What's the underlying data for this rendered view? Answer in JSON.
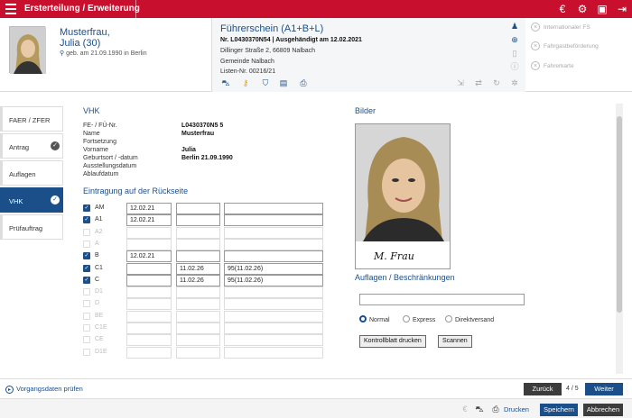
{
  "topbar": {
    "title": "Ersterteilung / Erweiterung",
    "icons": [
      "euro-icon",
      "gear-icon",
      "sidebar-toggle-icon",
      "logout-icon"
    ]
  },
  "person": {
    "name_line1": "Musterfrau,",
    "name_line2": "Julia (30)",
    "birth": "geb. am 21.09.1990 in Berlin"
  },
  "license": {
    "title": "Führerschein (A1+B+L)",
    "number_line": "Nr. L0430370N54 | Ausgehändigt am 12.02.2021",
    "address_line": "Dillinger Straße 2, 66809 Nalbach",
    "gemeinde_line": "Gemeinde Nalbach",
    "listen_line": "Listen-Nr. 00216/21"
  },
  "related": {
    "items": [
      "Internationaler FS",
      "Fahrgastbeförderung",
      "Fahrerkarte"
    ]
  },
  "nav": {
    "items": [
      {
        "label": "FAER / ZFER",
        "checked": false,
        "active": false
      },
      {
        "label": "Antrag",
        "checked": true,
        "active": false
      },
      {
        "label": "Auflagen",
        "checked": false,
        "active": false
      },
      {
        "label": "VHK",
        "checked": true,
        "active": true
      },
      {
        "label": "Prüfauftrag",
        "checked": false,
        "active": false
      }
    ]
  },
  "vhk": {
    "title": "VHK",
    "fields": [
      {
        "label": "FE- / FÜ-Nr.",
        "value": "L0430370N5    5"
      },
      {
        "label": "Name",
        "value": "Musterfrau"
      },
      {
        "label": "Fortsetzung",
        "value": ""
      },
      {
        "label": "Vorname",
        "value": "Julia"
      },
      {
        "label": "Geburtsort / -datum",
        "value": "Berlin    21.09.1990"
      },
      {
        "label": "Ausstellungsdatum",
        "value": ""
      },
      {
        "label": "Ablaufdatum",
        "value": ""
      }
    ]
  },
  "rueckseite": {
    "title": "Eintragung auf der Rückseite",
    "rows": [
      {
        "cls": "AM",
        "checked": true,
        "enabled": true,
        "date": "12.02.21",
        "end": "",
        "note": ""
      },
      {
        "cls": "A1",
        "checked": true,
        "enabled": true,
        "date": "12.02.21",
        "end": "",
        "note": ""
      },
      {
        "cls": "A2",
        "checked": false,
        "enabled": false,
        "date": "",
        "end": "",
        "note": ""
      },
      {
        "cls": "A",
        "checked": false,
        "enabled": false,
        "date": "",
        "end": "",
        "note": ""
      },
      {
        "cls": "B",
        "checked": true,
        "enabled": true,
        "date": "12.02.21",
        "end": "",
        "note": ""
      },
      {
        "cls": "C1",
        "checked": true,
        "enabled": true,
        "date": "",
        "end": "11.02.26",
        "note": "95(11.02.26)"
      },
      {
        "cls": "C",
        "checked": true,
        "enabled": true,
        "date": "",
        "end": "11.02.26",
        "note": "95(11.02.26)"
      },
      {
        "cls": "D1",
        "checked": false,
        "enabled": false,
        "date": "",
        "end": "",
        "note": ""
      },
      {
        "cls": "D",
        "checked": false,
        "enabled": false,
        "date": "",
        "end": "",
        "note": ""
      },
      {
        "cls": "BE",
        "checked": false,
        "enabled": false,
        "date": "",
        "end": "",
        "note": ""
      },
      {
        "cls": "C1E",
        "checked": false,
        "enabled": false,
        "date": "",
        "end": "",
        "note": ""
      },
      {
        "cls": "CE",
        "checked": false,
        "enabled": false,
        "date": "",
        "end": "",
        "note": ""
      },
      {
        "cls": "D1E",
        "checked": false,
        "enabled": false,
        "date": "",
        "end": "",
        "note": ""
      }
    ]
  },
  "bilder": {
    "title": "Bilder",
    "signature": "M. Frau"
  },
  "auflagen": {
    "title": "Auflagen / Beschränkungen",
    "input_value": "",
    "radios": [
      {
        "label": "Normal",
        "selected": true
      },
      {
        "label": "Express",
        "selected": false
      },
      {
        "label": "Direktversand",
        "selected": false
      }
    ],
    "btn_kontroll": "Kontrollblatt drucken",
    "btn_scannen": "Scannen"
  },
  "footer": {
    "vorgang_label": "Vorgangsdaten prüfen",
    "back_label": "Zurück",
    "pager": "4 / 5",
    "next_label": "Weiter",
    "drucken_label": "Drucken",
    "save_label": "Speichern",
    "cancel_label": "Abbrechen"
  },
  "colors": {
    "brand": "#c8102e",
    "accent": "#1b4f8a"
  }
}
